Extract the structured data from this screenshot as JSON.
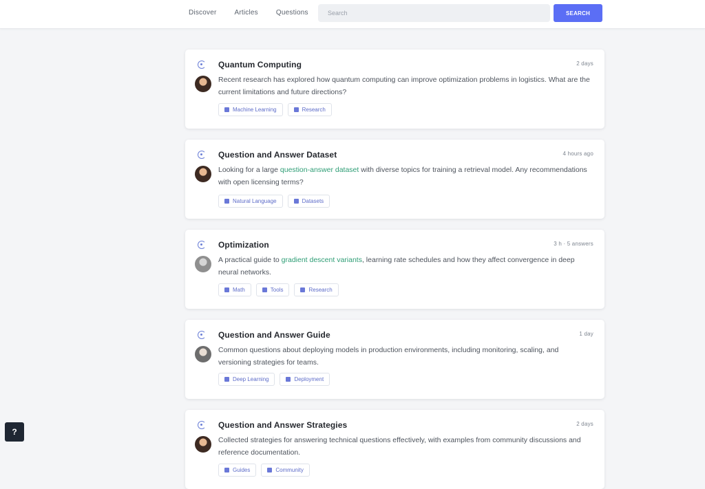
{
  "nav": {
    "items": [
      "Discover",
      "Articles",
      "Questions"
    ]
  },
  "search": {
    "placeholder": "Search",
    "button_label": "SEARCH"
  },
  "cards": [
    {
      "title": "Quantum Computing",
      "meta": "2 days",
      "text": "Recent research has explored how quantum computing can improve optimization problems in logistics. What are the current limitations and future directions?",
      "tags": [
        "Machine Learning",
        "Research"
      ]
    },
    {
      "title": "Question and Answer Dataset",
      "meta": "4 hours ago",
      "text": "Looking for a large question-answer dataset with diverse topics for training a retrieval model. Any recommendations with open licensing terms?",
      "highlight": "question-answer dataset",
      "tags": [
        "Natural Language",
        "Datasets"
      ]
    },
    {
      "title": "Optimization",
      "meta": "3 h · 5 answers",
      "text": "A practical guide to gradient descent variants, learning rate schedules and how they affect convergence in deep neural networks.",
      "highlight": "gradient descent variants",
      "tags": [
        "Math",
        "Tools",
        "Research"
      ]
    },
    {
      "title": "Question and Answer Guide",
      "meta": "1 day",
      "text": "Common questions about deploying models in production environments, including monitoring, scaling, and versioning strategies for teams.",
      "tags": [
        "Deep Learning",
        "Deployment"
      ]
    },
    {
      "title": "Question and Answer Strategies",
      "meta": "2 days",
      "text": "Collected strategies for answering technical questions effectively, with examples from community discussions and reference documentation.",
      "tags": [
        "Guides",
        "Community"
      ]
    }
  ],
  "help": {
    "label": "?"
  }
}
